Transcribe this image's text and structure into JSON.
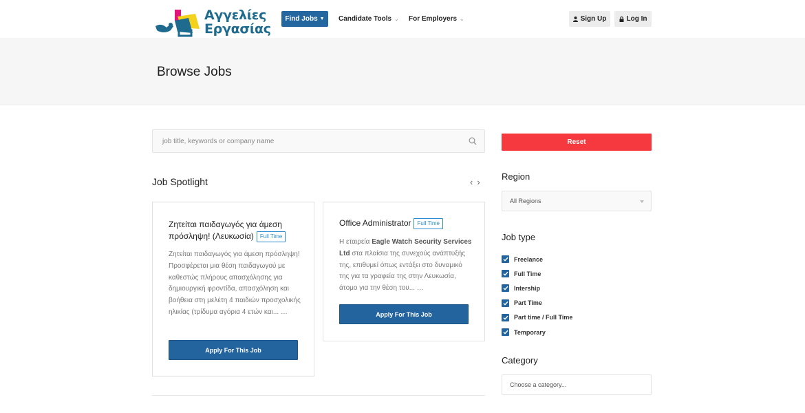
{
  "header": {
    "logo": {
      "line1": "Αγγελίες",
      "line2": "Εργασίας"
    },
    "nav": [
      {
        "label": "Find Jobs"
      },
      {
        "label": "Candidate Tools"
      },
      {
        "label": "For Employers"
      }
    ],
    "signup_label": "Sign Up",
    "login_label": "Log In"
  },
  "hero": {
    "title": "Browse Jobs"
  },
  "search": {
    "placeholder": "job title, keywords or company name"
  },
  "spotlight": {
    "title": "Job Spotlight",
    "jobs": [
      {
        "title": "Ζητείται παιδαγωγός για άμεση πρόσληψη! (Λευκωσία)",
        "badge": "Full Time",
        "description": "Ζητείται παιδαγωγός για άμεση πρόσληψη! Προσφέρεται μια θέση παιδαγωγού με καθεστώς πλήρους απασχόλησης για δημιουργική φροντίδα, απασχόληση και βοήθεια στη μελέτη 4 παιδιών προσχολικής ηλικίας (τρίδυμα αγόρια 4 ετών και... …",
        "apply_label": "Apply For This Job"
      },
      {
        "title": "Office Administrator",
        "badge": "Full Time",
        "desc_pre": "Η εταιρεία ",
        "desc_bold": "Eagle Watch Security Services Ltd",
        "desc_post": " στα πλαίσια της συνεχούς ανάπτυξής της, επιθυμεί όπως εντάξει στο δυναμικό της για τα γραφεία της στην Λευκωσία, άτομο για την θέση του... …",
        "apply_label": "Apply For This Job"
      }
    ]
  },
  "sidebar": {
    "reset_label": "Reset",
    "region_label": "Region",
    "region_value": "All Regions",
    "jobtype_label": "Job type",
    "job_types": [
      "Freelance",
      "Full Time",
      "Intership",
      "Part Time",
      "Part time / Full Time",
      "Temporary"
    ],
    "category_label": "Category",
    "category_placeholder": "Choose a category..."
  },
  "colors": {
    "primary": "#24649e",
    "reset": "#f5393f",
    "logo_text": "#1e6b8f",
    "badge": "#2a8ccc"
  }
}
